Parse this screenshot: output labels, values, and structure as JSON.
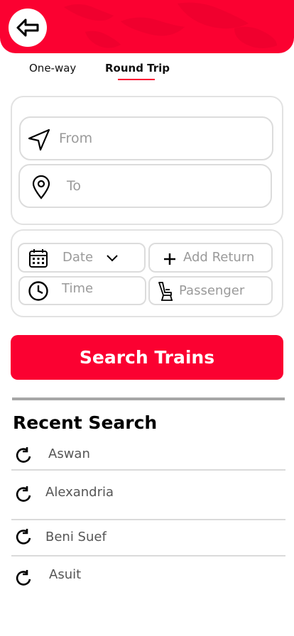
{
  "header": {
    "back_icon": "arrow-left-icon",
    "color": "#fb0131"
  },
  "tabs": [
    {
      "label": "One-way",
      "active": false
    },
    {
      "label": "Round Trip",
      "active": true
    }
  ],
  "route": {
    "from": {
      "placeholder": "From",
      "icon": "navigation-arrow-icon"
    },
    "to": {
      "placeholder": "To",
      "icon": "map-pin-icon"
    }
  },
  "details": {
    "date": {
      "placeholder": "Date",
      "icon": "calendar-icon"
    },
    "add_return": {
      "label": "Add Return",
      "icon": "plus-icon"
    },
    "time": {
      "placeholder": "Time",
      "icon": "clock-icon"
    },
    "passenger": {
      "placeholder": "Passenger",
      "icon": "seat-icon"
    }
  },
  "search_button": {
    "label": "Search Trains"
  },
  "recent": {
    "title": "Recent Search",
    "items": [
      "Aswan",
      "Alexandria",
      "Beni Suef",
      "Asuit"
    ],
    "icon": "refresh-icon"
  }
}
